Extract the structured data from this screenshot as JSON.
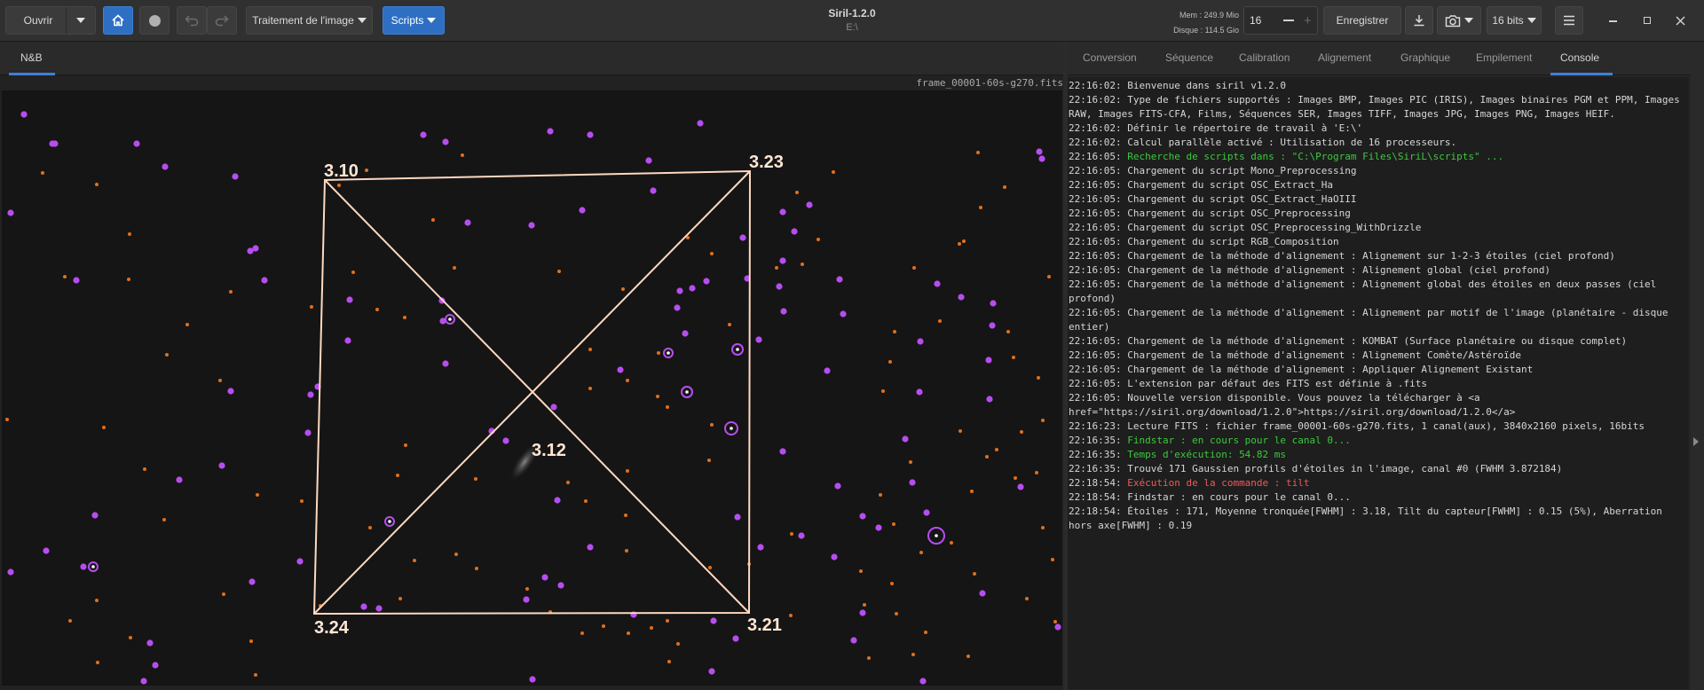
{
  "toolbar": {
    "open_label": "Ouvrir",
    "image_processing_label": "Traitement de l'image",
    "scripts_label": "Scripts",
    "title": "Siril-1.2.0",
    "working_dir": "E:\\",
    "memory": "Mem : 249.9 Mio",
    "disk": "Disque : 114.5 Gio",
    "thread_count": "16",
    "save_label": "Enregistrer",
    "bit_depth": "16 bits"
  },
  "left_tabs": [
    {
      "label": "N&B"
    }
  ],
  "image": {
    "filename": "frame_00001-60s-g270.fits",
    "tilt_values": {
      "top_left": "3.10",
      "top_right": "3.23",
      "center": "3.12",
      "bottom_left": "3.24",
      "bottom_right": "3.21"
    }
  },
  "right_tabs": [
    {
      "label": "Conversion"
    },
    {
      "label": "Séquence"
    },
    {
      "label": "Calibration"
    },
    {
      "label": "Alignement"
    },
    {
      "label": "Graphique"
    },
    {
      "label": "Empilement"
    },
    {
      "label": "Console"
    }
  ],
  "colors": {
    "accent": "#2f6fc3",
    "star_detected": "#b74df0",
    "star_other": "#e0701c",
    "tilt_lines": "#ffd9c0",
    "log_green": "#3cc93c",
    "log_red": "#f05a5a"
  },
  "console_lines": [
    {
      "time": "22:16:02:",
      "text": "Bienvenue dans siril v1.2.0",
      "color": "default"
    },
    {
      "time": "22:16:02:",
      "text": "Type de fichiers supportés : Images BMP, Images PIC (IRIS), Images binaires PGM et PPM, Images RAW, Images FITS-CFA, Films, Séquences SER, Images TIFF, Images JPG, Images PNG, Images HEIF.",
      "color": "default"
    },
    {
      "time": "22:16:02:",
      "text": "Définir le répertoire de travail à 'E:\\'",
      "color": "default"
    },
    {
      "time": "22:16:02:",
      "text": "Calcul parallèle activé : Utilisation de 16 processeurs.",
      "color": "default"
    },
    {
      "time": "22:16:05:",
      "text": "Recherche de scripts dans : \"C:\\Program Files\\SiriL\\scripts\" ...",
      "color": "green"
    },
    {
      "time": "22:16:05:",
      "text": "Chargement du script Mono_Preprocessing",
      "color": "default"
    },
    {
      "time": "22:16:05:",
      "text": "Chargement du script OSC_Extract_Ha",
      "color": "default"
    },
    {
      "time": "22:16:05:",
      "text": "Chargement du script OSC_Extract_HaOIII",
      "color": "default"
    },
    {
      "time": "22:16:05:",
      "text": "Chargement du script OSC_Preprocessing",
      "color": "default"
    },
    {
      "time": "22:16:05:",
      "text": "Chargement du script OSC_Preprocessing_WithDrizzle",
      "color": "default"
    },
    {
      "time": "22:16:05:",
      "text": "Chargement du script RGB_Composition",
      "color": "default"
    },
    {
      "time": "22:16:05:",
      "text": "Chargement de la méthode d'alignement : Alignement sur 1-2-3 étoiles (ciel profond)",
      "color": "default"
    },
    {
      "time": "22:16:05:",
      "text": "Chargement de la méthode d'alignement : Alignement global (ciel profond)",
      "color": "default"
    },
    {
      "time": "22:16:05:",
      "text": "Chargement de la méthode d'alignement : Alignement global des étoiles en deux passes (ciel profond)",
      "color": "default"
    },
    {
      "time": "22:16:05:",
      "text": "Chargement de la méthode d'alignement : Alignement par motif de l'image (planétaire - disque entier)",
      "color": "default"
    },
    {
      "time": "22:16:05:",
      "text": "Chargement de la méthode d'alignement : KOMBAT (Surface planétaire ou disque complet)",
      "color": "default"
    },
    {
      "time": "22:16:05:",
      "text": "Chargement de la méthode d'alignement : Alignement Comète/Astéroïde",
      "color": "default"
    },
    {
      "time": "22:16:05:",
      "text": "Chargement de la méthode d'alignement : Appliquer Alignement Existant",
      "color": "default"
    },
    {
      "time": "22:16:05:",
      "text": "L'extension par défaut des FITS est définie à .fits",
      "color": "default"
    },
    {
      "time": "22:16:05:",
      "text": "Nouvelle version disponible. Vous pouvez la télécharger à <a href=\"https://siril.org/download/1.2.0\">https://siril.org/download/1.2.0</a>",
      "color": "default"
    },
    {
      "time": "22:16:23:",
      "text": "Lecture FITS : fichier frame_00001-60s-g270.fits, 1 canal(aux), 3840x2160 pixels, 16bits",
      "color": "default"
    },
    {
      "time": "22:16:35:",
      "text": "Findstar : en cours pour le canal 0...",
      "color": "green"
    },
    {
      "time": "22:16:35:",
      "text": "Temps d'exécution: 54.82 ms",
      "color": "green"
    },
    {
      "time": "22:16:35:",
      "text": "Trouvé 171 Gaussien profils d'étoiles in l'image, canal #0 (FWHM 3.872184)",
      "color": "default"
    },
    {
      "time": "22:18:54:",
      "text": "Exécution de la commande : tilt",
      "color": "red"
    },
    {
      "time": "22:18:54:",
      "text": "Findstar : en cours pour le canal 0...",
      "color": "default"
    },
    {
      "time": "22:18:54:",
      "text": "Étoiles : 171, Moyenne tronquée[FWHM] : 3.18, Tilt du capteur[FWHM] : 0.15 (5%), Aberration hors axe[FWHM] : 0.19",
      "color": "default"
    }
  ]
}
